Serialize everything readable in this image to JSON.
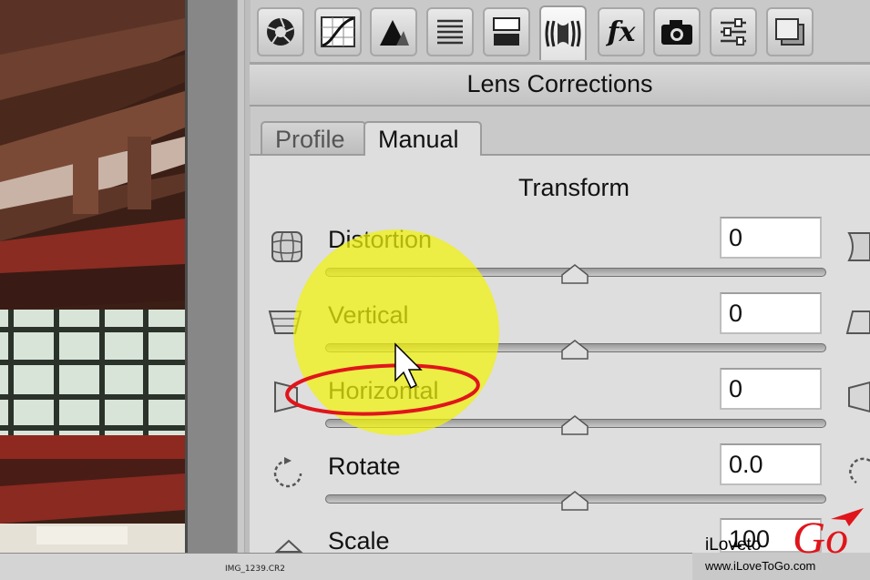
{
  "preview": {
    "filename": "IMG_1239.CR2"
  },
  "toolbar": {
    "tools": [
      {
        "icon": "aperture-icon"
      },
      {
        "icon": "tone-curve-icon"
      },
      {
        "icon": "detail-icon"
      },
      {
        "icon": "hsl-icon"
      },
      {
        "icon": "split-toning-icon"
      },
      {
        "icon": "lens-corrections-icon",
        "active": true
      },
      {
        "icon": "effects-icon",
        "label": "fx"
      },
      {
        "icon": "camera-calibration-icon"
      },
      {
        "icon": "presets-icon"
      },
      {
        "icon": "snapshots-icon"
      }
    ]
  },
  "panel": {
    "title": "Lens Corrections",
    "tabs": [
      {
        "label": "Profile",
        "active": false
      },
      {
        "label": "Manual",
        "active": true
      }
    ],
    "section": "Transform",
    "rows": [
      {
        "label": "Distortion",
        "value": "0"
      },
      {
        "label": "Vertical",
        "value": "0"
      },
      {
        "label": "Horizontal",
        "value": "0"
      },
      {
        "label": "Rotate",
        "value": "0.0"
      },
      {
        "label": "Scale",
        "value": "100"
      }
    ]
  },
  "annotations": {
    "highlight_color": "#f1f20a",
    "circle_color": "#e0151b"
  },
  "watermark": {
    "brand_prefix": "iLoveto",
    "brand_suffix": "Go",
    "url": "www.iLoveToGo.com"
  }
}
